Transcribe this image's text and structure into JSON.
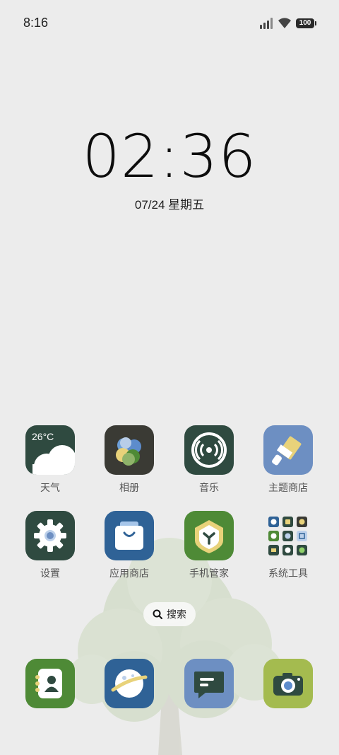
{
  "status_bar": {
    "time": "8:16",
    "battery": "100"
  },
  "lock_clock": {
    "time": "02:36",
    "date": "07/24 星期五"
  },
  "weather_icon_temp": "26°C",
  "apps": [
    {
      "label": "天气",
      "icon": "weather-icon"
    },
    {
      "label": "相册",
      "icon": "gallery-icon"
    },
    {
      "label": "音乐",
      "icon": "music-icon"
    },
    {
      "label": "主题商店",
      "icon": "theme-store-icon"
    },
    {
      "label": "设置",
      "icon": "settings-icon"
    },
    {
      "label": "应用商店",
      "icon": "app-store-icon"
    },
    {
      "label": "手机管家",
      "icon": "phone-manager-icon"
    },
    {
      "label": "系统工具",
      "icon": "system-tools-folder-icon"
    }
  ],
  "search": {
    "label": "搜索"
  },
  "dock": [
    {
      "icon": "contacts-icon"
    },
    {
      "icon": "browser-icon"
    },
    {
      "icon": "messages-icon"
    },
    {
      "icon": "camera-icon"
    }
  ],
  "colors": {
    "background": "#ececec",
    "dark_green": "#2f4a40",
    "navy_blue": "#2f6296",
    "light_blue": "#6d8fc2",
    "leaf_green": "#4e8a36",
    "olive": "#a4bb4f"
  }
}
